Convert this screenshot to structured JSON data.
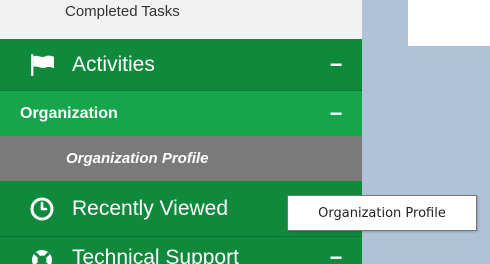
{
  "sidebar": {
    "completed_tasks": {
      "label": "Completed Tasks"
    },
    "activities": {
      "label": "Activities",
      "icon": "flag-icon",
      "toggle": "−"
    },
    "organization": {
      "label": "Organization",
      "toggle": "−"
    },
    "organization_profile": {
      "label": "Organization Profile"
    },
    "recently_viewed": {
      "label": "Recently Viewed",
      "icon": "clock-icon"
    },
    "technical_support": {
      "label": "Technical Support",
      "icon": "lifebuoy-icon",
      "toggle": "−"
    }
  },
  "tooltip": {
    "text": "Organization Profile"
  },
  "colors": {
    "sidebar_dark_green": "#0f8a3c",
    "sidebar_light_green": "#16a54d",
    "selected_gray": "#7a7a7a",
    "content_background": "#b0c2d8"
  }
}
